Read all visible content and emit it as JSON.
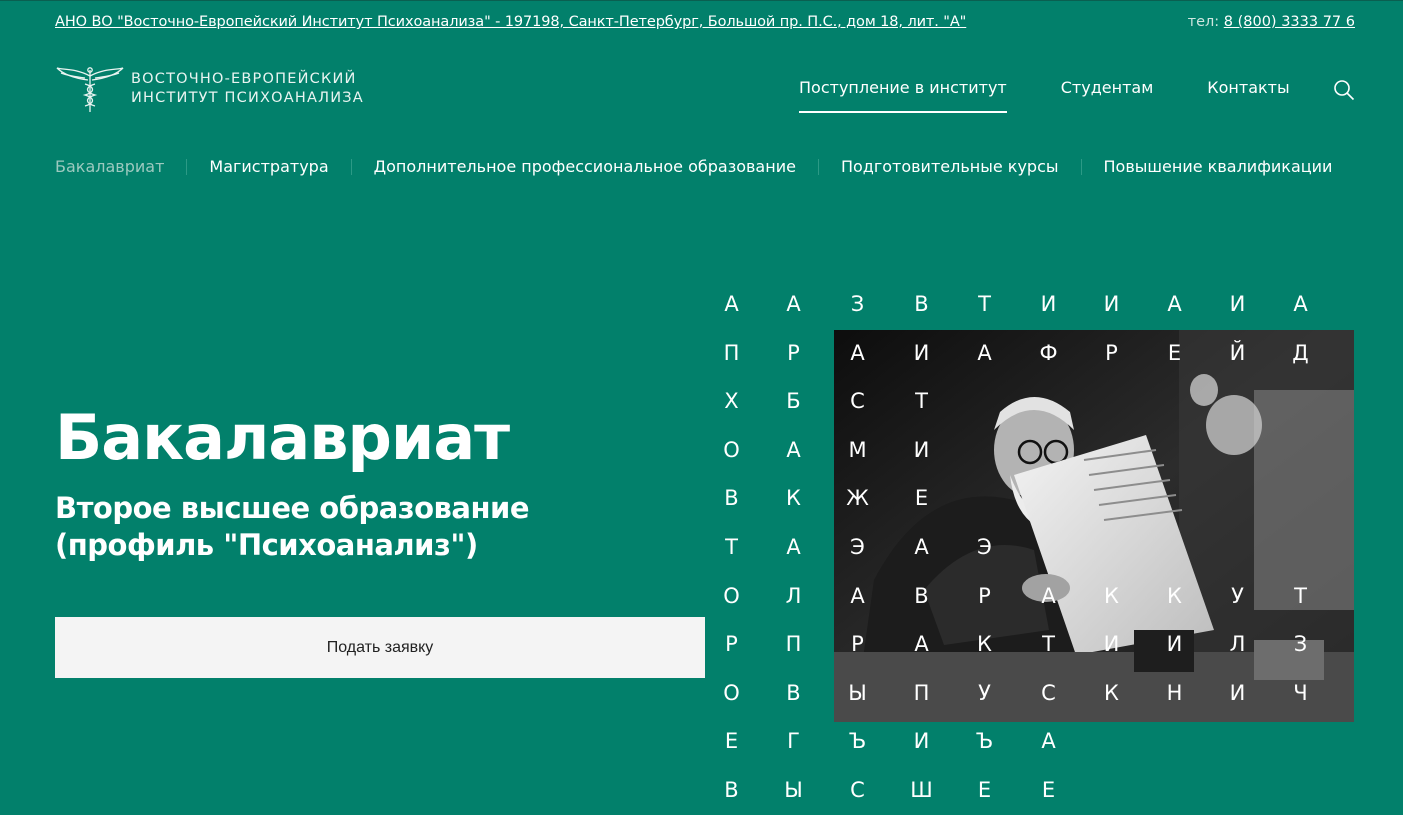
{
  "topbar": {
    "address": "АНО ВО \"Восточно-Европейский Институт Психоанализа\" - 197198, Санкт-Петербург, Большой пр. П.С., дом 18, лит. \"А\"",
    "phone_label": "тел:",
    "phone": "8 (800) 3333 77 6"
  },
  "logo": {
    "line1": "ВОСТОЧНО-ЕВРОПЕЙСКИЙ",
    "line2": "ИНСТИТУТ ПСИХОАНАЛИЗА",
    "icon": "winged-caduceus-logo"
  },
  "main_nav": [
    {
      "label": "Поступление в институт",
      "active": true
    },
    {
      "label": "Студентам"
    },
    {
      "label": "Контакты"
    }
  ],
  "search_icon": "search-icon",
  "sub_nav": [
    {
      "label": "Бакалавриат",
      "current": true
    },
    {
      "label": "Магистратура"
    },
    {
      "label": "Дополнительное профессиональное образование"
    },
    {
      "label": "Подготовительные курсы"
    },
    {
      "label": "Повышение квалификации"
    }
  ],
  "hero": {
    "title": "Бакалавриат",
    "subtitle": "Второе высшее образование (профиль \"Психоанализ\")",
    "button": "Подать заявку"
  },
  "photo": {
    "alt": "black-and-white-photo-man-reading-manuscript"
  },
  "letter_grid": [
    [
      "А",
      "А",
      "З",
      "В",
      "Т",
      "И",
      "И",
      "А",
      "И",
      "А"
    ],
    [
      "П",
      "Р",
      "А",
      "И",
      "А",
      "Ф",
      "Р",
      "Е",
      "Й",
      "Д"
    ],
    [
      "Х",
      "Б",
      "С",
      "Т"
    ],
    [
      "О",
      "А",
      "М",
      "И"
    ],
    [
      "В",
      "К",
      "Ж",
      "Е"
    ],
    [
      "Т",
      "А",
      "Э",
      "А",
      "Э"
    ],
    [
      "О",
      "Л",
      "А",
      "В",
      "Р",
      "А",
      "К",
      "К",
      "У",
      "Т"
    ],
    [
      "Р",
      "П",
      "Р",
      "А",
      "К",
      "Т",
      "И",
      "И",
      "Л",
      "З"
    ],
    [
      "О",
      "В",
      "Ы",
      "П",
      "У",
      "С",
      "К",
      "Н",
      "И",
      "Ч"
    ],
    [
      "Е",
      "Г",
      "Ъ",
      "И",
      "Ъ",
      "А"
    ],
    [
      "В",
      "Ы",
      "С",
      "Ш",
      "Е",
      "Е"
    ]
  ],
  "colors": {
    "background": "#02806b",
    "button_bg": "#f4f4f4",
    "current_subnav": "#9cc9bf"
  }
}
